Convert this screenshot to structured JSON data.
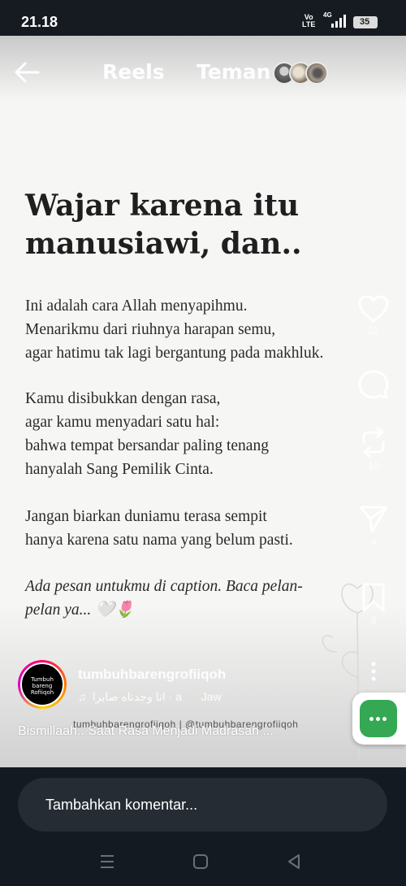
{
  "status": {
    "time": "21.18",
    "volte_top": "Vo",
    "volte_bottom": "LTE",
    "network": "4G",
    "battery": "35"
  },
  "header": {
    "tabs": [
      "Reels",
      "Teman"
    ],
    "back_icon": "arrow-left-icon"
  },
  "post": {
    "headline_line1": "Wajar karena itu",
    "headline_line2": "manusiawi, dan..",
    "para1": [
      "Ini adalah cara Allah menyapihmu.",
      "Menarikmu dari riuhnya harapan semu,",
      "agar hatimu tak lagi bergantung pada makhluk."
    ],
    "para2": [
      "Kamu disibukkan dengan rasa,",
      "agar kamu menyadari satu hal:",
      "bahwa tempat bersandar paling tenang",
      "hanyalah Sang Pemilik Cinta."
    ],
    "para3": [
      "Jangan biarkan duniamu terasa sempit",
      "hanya karena satu nama yang belum pasti."
    ],
    "para4_line1": "Ada pesan untukmu di caption. Baca pelan-",
    "para4_line2": "pelan ya...",
    "para4_emoji": "🤍🌷"
  },
  "actions": {
    "likes": "52",
    "reposts": "10",
    "shares": "4",
    "saves": "6"
  },
  "creator": {
    "avatar_text": "Tumbuh bareng Rofiiqoh",
    "username": "tumbuhbarengrofiiqoh",
    "audio": "انا وجدناه صابرا · a",
    "audio_tail": "Jaw",
    "overlay_text": "tumbuhbarengrofiiqoh | @tumbuhbarengrofiiqoh",
    "caption": "Bismillaah.. Saat Rasa Menjadi Madrasah ..."
  },
  "comment": {
    "placeholder": "Tambahkan komentar..."
  },
  "colors": {
    "background": "#f6f6f5",
    "chrome": "#141a22",
    "chat_button": "#34a853"
  }
}
